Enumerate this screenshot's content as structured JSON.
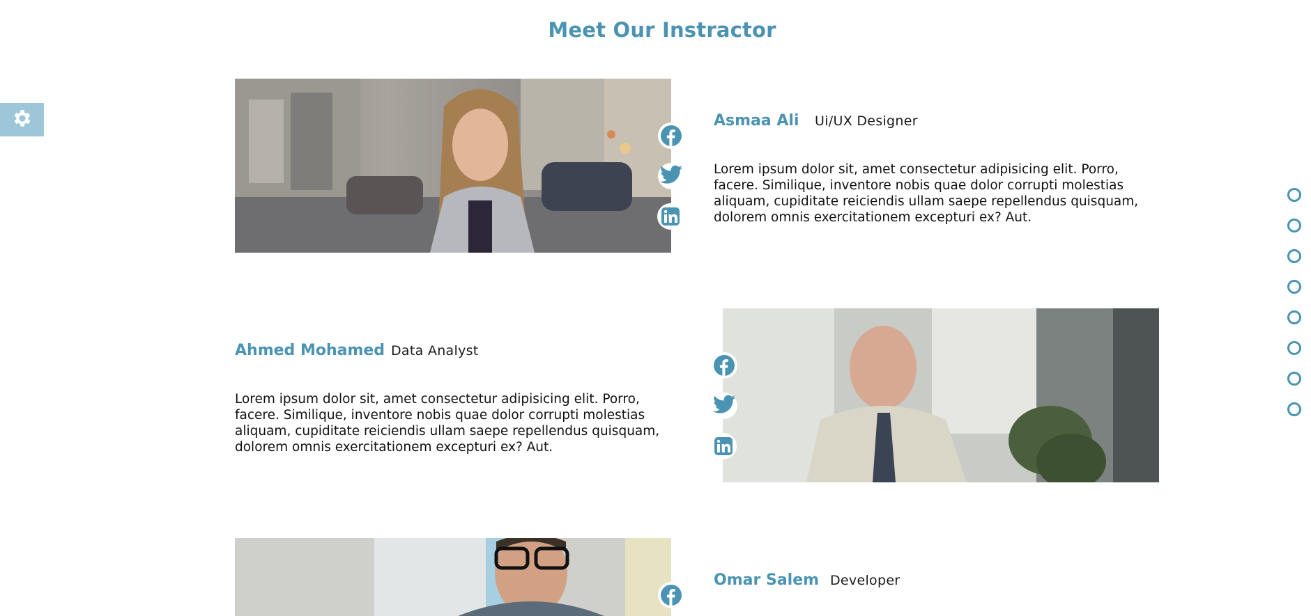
{
  "section": {
    "title": "Meet Our Instractor"
  },
  "settings": {
    "icon": "gear-icon"
  },
  "instructors": [
    {
      "name": "Asmaa Ali",
      "role": "Ui/UX Designer",
      "bio": "Lorem ipsum dolor sit, amet consectetur adipisicing elit. Porro, facere. Similique, inventore nobis quae dolor corrupti molestias aliquam, cupiditate reiciendis ullam saepe repellendus quisquam, dolorem omnis exercitationem excepturi ex? Aut.",
      "social": [
        "facebook-icon",
        "twitter-icon",
        "linkedin-icon"
      ]
    },
    {
      "name": "Ahmed Mohamed",
      "role": "Data Analyst",
      "bio": "Lorem ipsum dolor sit, amet consectetur adipisicing elit. Porro, facere. Similique, inventore nobis quae dolor corrupti molestias aliquam, cupiditate reiciendis ullam saepe repellendus quisquam, dolorem omnis exercitationem excepturi ex? Aut.",
      "social": [
        "facebook-icon",
        "twitter-icon",
        "linkedin-icon"
      ]
    },
    {
      "name": "Omar Salem",
      "role": "Developer",
      "social": [
        "facebook-icon"
      ]
    }
  ],
  "nav_dots": {
    "count": 8
  },
  "colors": {
    "accent": "#4a93b3",
    "settings_bg": "#9cc7d8"
  }
}
